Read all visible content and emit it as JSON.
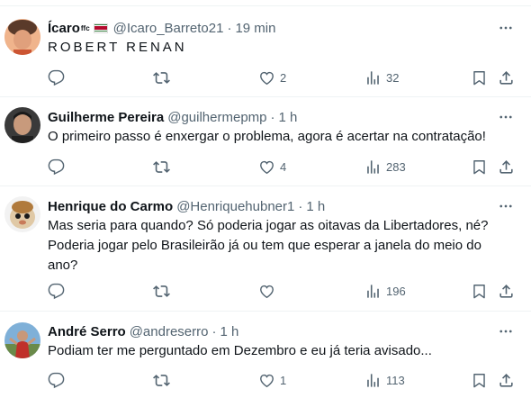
{
  "tweets": [
    {
      "name": "Ícaro",
      "badge": "ffc",
      "handle": "@Icaro_Barreto21",
      "separator": "·",
      "time": "19 min",
      "text": "ROBERT RENAN",
      "replies": "",
      "retweets": "",
      "likes": "2",
      "views": "32"
    },
    {
      "name": "Guilherme Pereira",
      "handle": "@guilhermepmp",
      "separator": "·",
      "time": "1 h",
      "text": "O primeiro passo é enxergar o problema, agora é acertar na contratação!",
      "replies": "",
      "retweets": "",
      "likes": "4",
      "views": "283"
    },
    {
      "name": "Henrique do Carmo",
      "handle": "@Henriquehubner1",
      "separator": "·",
      "time": "1 h",
      "text": "Mas seria para quando? Só poderia jogar as oitavas da Libertadores, né? Poderia jogar pelo Brasileirão já ou tem que esperar a janela do meio do ano?",
      "replies": "",
      "retweets": "",
      "likes": "",
      "views": "196"
    },
    {
      "name": "André Serro",
      "handle": "@andreserro",
      "separator": "·",
      "time": "1 h",
      "text": "Podiam ter me perguntado em Dezembro e eu já teria avisado...",
      "replies": "",
      "retweets": "",
      "likes": "1",
      "views": "113"
    }
  ],
  "icons": {
    "more": "more-horizontal-icon",
    "reply": "reply-icon",
    "retweet": "retweet-icon",
    "like": "heart-icon",
    "views": "views-icon",
    "bookmark": "bookmark-icon",
    "share": "share-icon",
    "flag": "suriname-flag-icon"
  },
  "colors": {
    "text": "#0f1419",
    "secondary": "#536471",
    "divider": "#eff3f4"
  }
}
